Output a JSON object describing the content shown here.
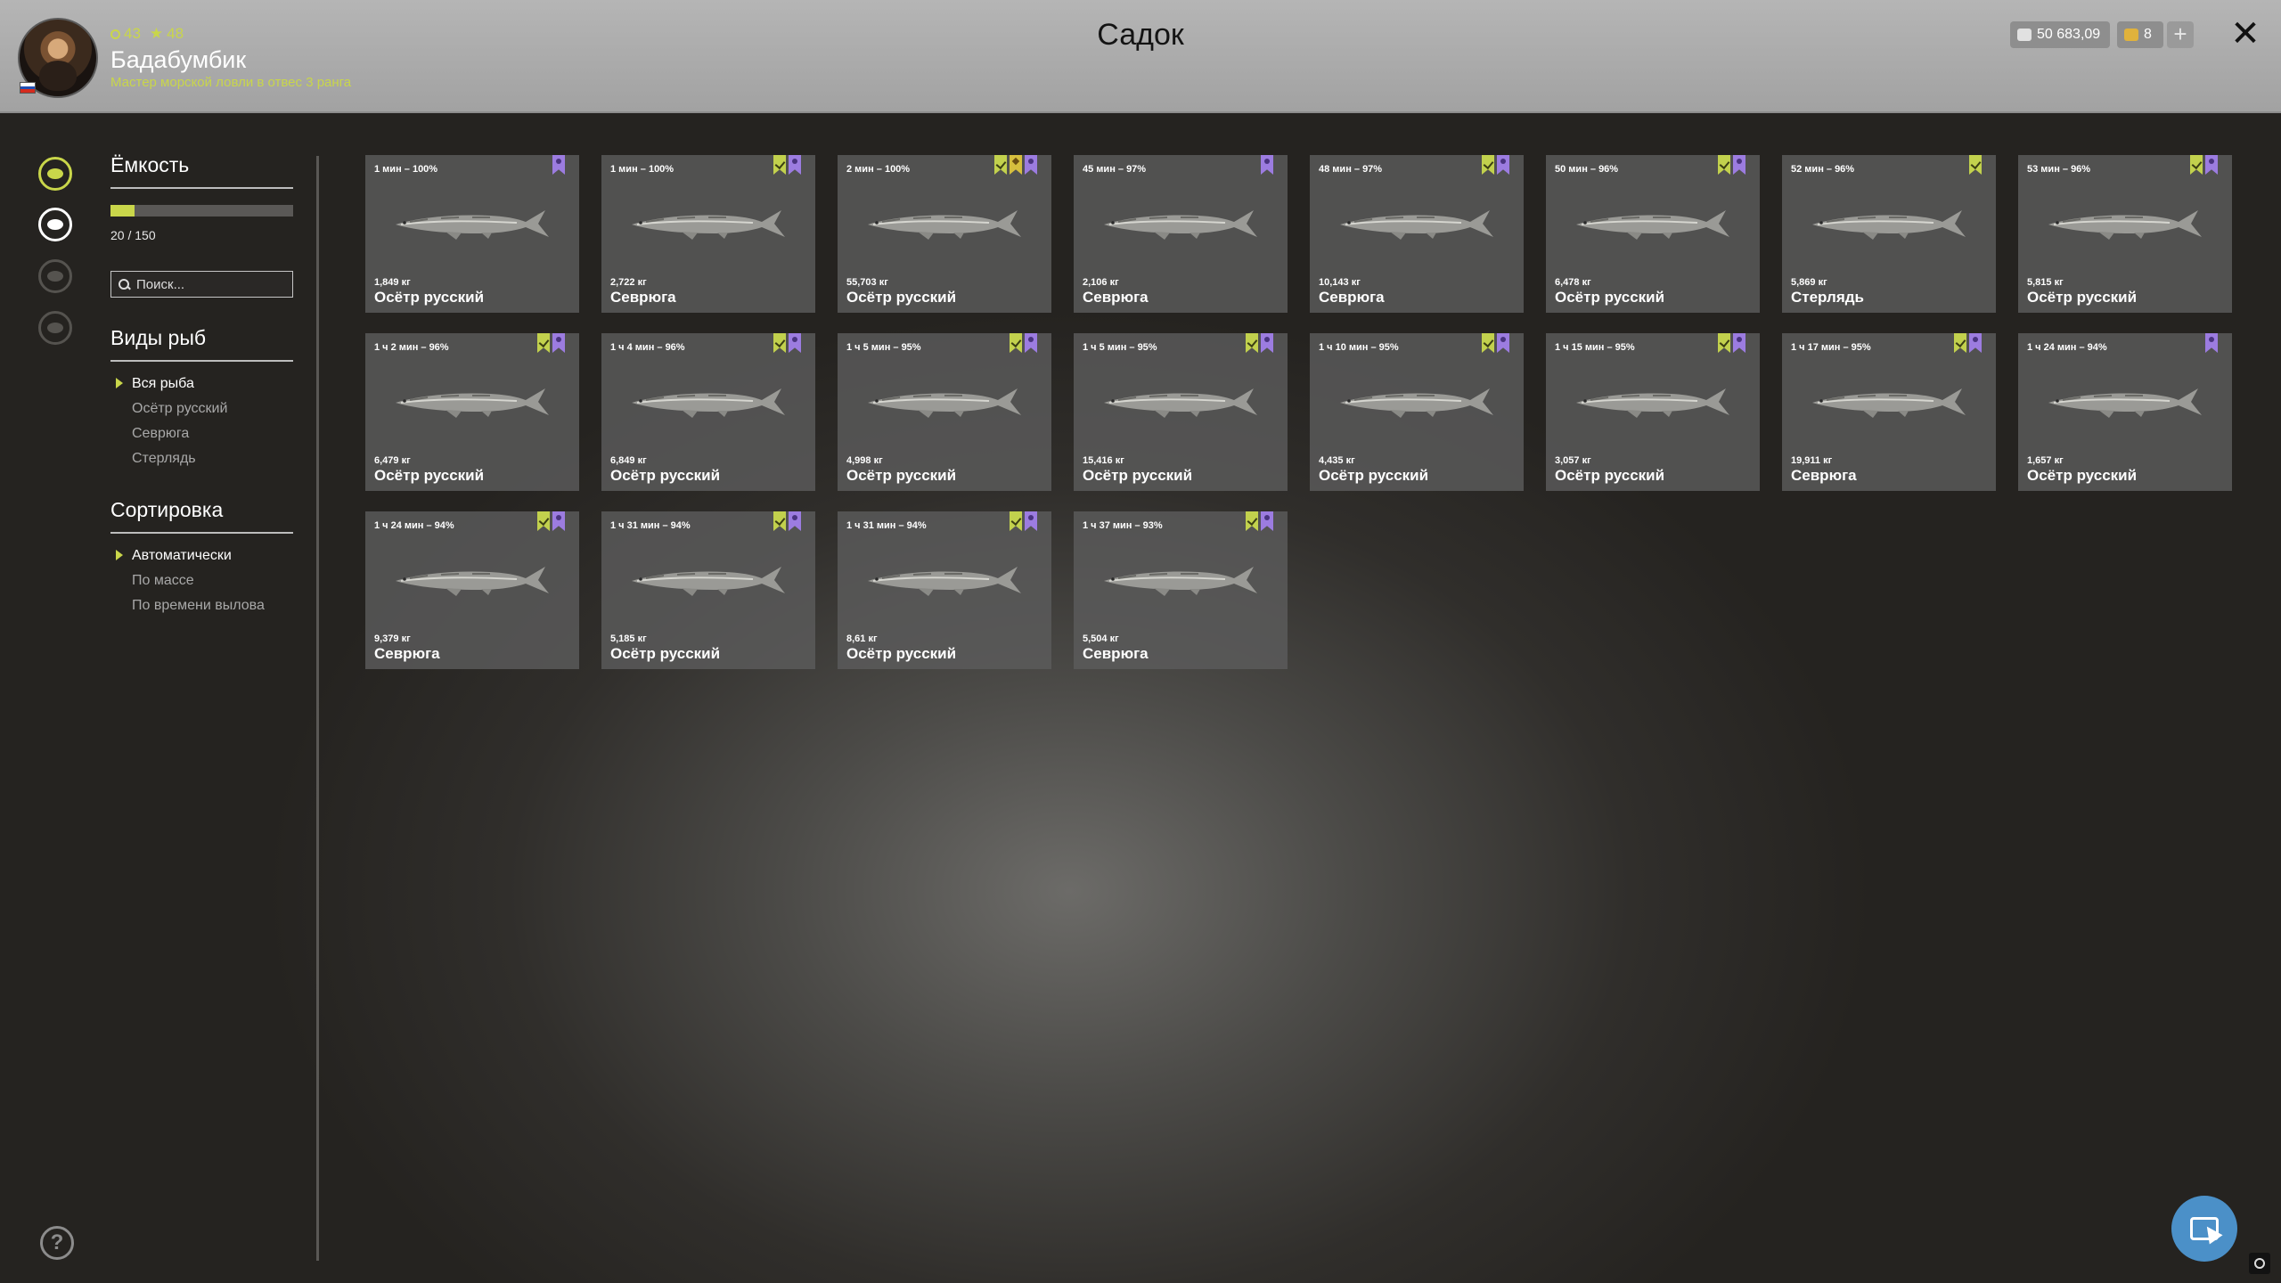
{
  "header": {
    "title": "Садок",
    "player_name": "Бадабумбик",
    "player_title": "Мастер морской ловли в отвес 3 ранга",
    "level": "43",
    "rank": "48",
    "silver": "50 683,09",
    "gold": "8",
    "add_label": "+",
    "close_label": "✕",
    "flag_colors": [
      "#ffffff",
      "#1f4fb4",
      "#d52b1e"
    ]
  },
  "sidebar_icons": [
    "fish-icon",
    "keepnet-icon",
    "boat-icon",
    "home-icon"
  ],
  "filters": {
    "capacity_title": "Ёмкость",
    "capacity_current": 20,
    "capacity_max": 150,
    "capacity_text": "20 / 150",
    "search_placeholder": "Поиск...",
    "species_title": "Виды рыб",
    "species": [
      "Вся рыба",
      "Осётр русский",
      "Севрюга",
      "Стерлядь"
    ],
    "species_selected": 0,
    "sort_title": "Сортировка",
    "sort_options": [
      "Автоматически",
      "По массе",
      "По времени вылова"
    ],
    "sort_selected": 0,
    "help_label": "?"
  },
  "colors": {
    "accent": "#c9d64a",
    "badge_green": "#c2d14d",
    "badge_purple": "#9c7ce0",
    "badge_yellow": "#d6bf3e",
    "card_bg": "#5c5c5c"
  },
  "fish": [
    {
      "time": "1 мин – 100%",
      "weight": "1,849 кг",
      "name": "Осётр русский",
      "badges": [
        "p"
      ]
    },
    {
      "time": "1 мин – 100%",
      "weight": "2,722 кг",
      "name": "Севрюга",
      "badges": [
        "g",
        "p"
      ]
    },
    {
      "time": "2 мин – 100%",
      "weight": "55,703 кг",
      "name": "Осётр русский",
      "badges": [
        "g",
        "y",
        "p"
      ]
    },
    {
      "time": "45 мин – 97%",
      "weight": "2,106 кг",
      "name": "Севрюга",
      "badges": [
        "p"
      ]
    },
    {
      "time": "48 мин – 97%",
      "weight": "10,143 кг",
      "name": "Севрюга",
      "badges": [
        "g",
        "p"
      ]
    },
    {
      "time": "50 мин – 96%",
      "weight": "6,478 кг",
      "name": "Осётр русский",
      "badges": [
        "g",
        "p"
      ]
    },
    {
      "time": "52 мин – 96%",
      "weight": "5,869 кг",
      "name": "Стерлядь",
      "badges": [
        "g"
      ]
    },
    {
      "time": "53 мин – 96%",
      "weight": "5,815 кг",
      "name": "Осётр русский",
      "badges": [
        "g",
        "p"
      ]
    },
    {
      "time": "1 ч 2 мин – 96%",
      "weight": "6,479 кг",
      "name": "Осётр русский",
      "badges": [
        "g",
        "p"
      ]
    },
    {
      "time": "1 ч 4 мин – 96%",
      "weight": "6,849 кг",
      "name": "Осётр русский",
      "badges": [
        "g",
        "p"
      ]
    },
    {
      "time": "1 ч 5 мин – 95%",
      "weight": "4,998 кг",
      "name": "Осётр русский",
      "badges": [
        "g",
        "p"
      ]
    },
    {
      "time": "1 ч 5 мин – 95%",
      "weight": "15,416 кг",
      "name": "Осётр русский",
      "badges": [
        "g",
        "p"
      ]
    },
    {
      "time": "1 ч 10 мин – 95%",
      "weight": "4,435 кг",
      "name": "Осётр русский",
      "badges": [
        "g",
        "p"
      ]
    },
    {
      "time": "1 ч 15 мин – 95%",
      "weight": "3,057 кг",
      "name": "Осётр русский",
      "badges": [
        "g",
        "p"
      ]
    },
    {
      "time": "1 ч 17 мин – 95%",
      "weight": "19,911 кг",
      "name": "Севрюга",
      "badges": [
        "g",
        "p"
      ]
    },
    {
      "time": "1 ч 24 мин – 94%",
      "weight": "1,657 кг",
      "name": "Осётр русский",
      "badges": [
        "p"
      ]
    },
    {
      "time": "1 ч 24 мин – 94%",
      "weight": "9,379 кг",
      "name": "Севрюга",
      "badges": [
        "g",
        "p"
      ]
    },
    {
      "time": "1 ч 31 мин – 94%",
      "weight": "5,185 кг",
      "name": "Осётр русский",
      "badges": [
        "g",
        "p"
      ]
    },
    {
      "time": "1 ч 31 мин – 94%",
      "weight": "8,61 кг",
      "name": "Осётр русский",
      "badges": [
        "g",
        "p"
      ]
    },
    {
      "time": "1 ч 37 мин – 93%",
      "weight": "5,504 кг",
      "name": "Севрюга",
      "badges": [
        "g",
        "p"
      ]
    }
  ]
}
